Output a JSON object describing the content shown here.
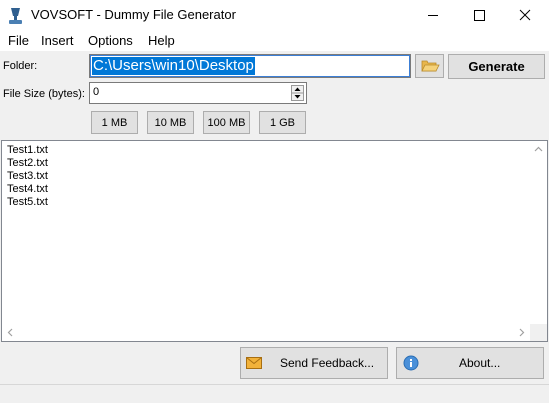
{
  "window": {
    "title": "VOVSOFT - Dummy File Generator"
  },
  "menu": {
    "items": [
      {
        "label": "File"
      },
      {
        "label": "Insert"
      },
      {
        "label": "Options"
      },
      {
        "label": "Help"
      }
    ]
  },
  "form": {
    "folder_label": "Folder:",
    "folder_value": "C:\\Users\\win10\\Desktop",
    "generate_label": "Generate",
    "size_label": "File Size (bytes):",
    "size_value": "0",
    "presets": [
      {
        "label": "1 MB"
      },
      {
        "label": "10 MB"
      },
      {
        "label": "100 MB"
      },
      {
        "label": "1 GB"
      }
    ]
  },
  "output": {
    "lines": [
      "Test1.txt",
      "Test2.txt",
      "Test3.txt",
      "Test4.txt",
      "Test5.txt"
    ]
  },
  "footer": {
    "feedback_label": "Send Feedback...",
    "about_label": "About..."
  },
  "icons": {
    "app": "app-icon",
    "browse": "folder-open-icon",
    "feedback": "envelope-icon",
    "about": "info-icon"
  },
  "colors": {
    "selection": "#0078d7",
    "button_face": "#e1e1e1",
    "window_bg": "#f0f0f0"
  }
}
